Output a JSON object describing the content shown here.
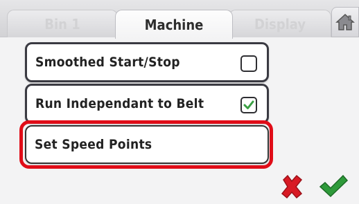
{
  "tabs": [
    {
      "label": "Bin 1",
      "active": false
    },
    {
      "label": "Machine",
      "active": true
    },
    {
      "label": "Display",
      "active": false
    }
  ],
  "home": {
    "icon": "home-icon"
  },
  "items": [
    {
      "label": "Smoothed Start/Stop",
      "checked": false
    },
    {
      "label": "Run Independant to Belt",
      "checked": true
    },
    {
      "label": "Set Speed Points"
    }
  ],
  "actions": {
    "cancel_icon": "x-icon",
    "confirm_icon": "checkmark-icon"
  },
  "colors": {
    "highlight": "#e00d18",
    "cancel": "#d81a24",
    "confirm": "#2e9a3a"
  }
}
